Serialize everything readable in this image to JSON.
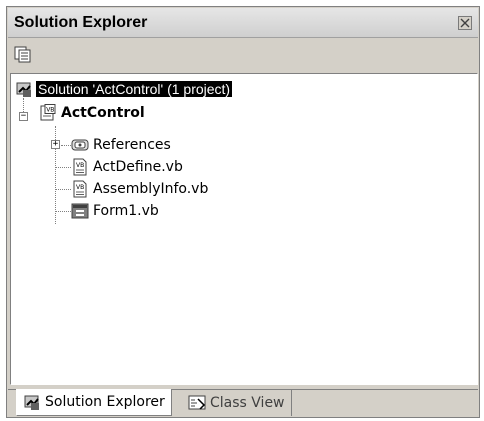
{
  "window": {
    "title": "Solution Explorer"
  },
  "tree": {
    "solution_label": "Solution 'ActControl' (1 project)",
    "project_label": "ActControl",
    "items": [
      {
        "label": "References",
        "icon": "references-icon"
      },
      {
        "label": "ActDefine.vb",
        "icon": "vb-file-icon"
      },
      {
        "label": "AssemblyInfo.vb",
        "icon": "vb-file-icon"
      },
      {
        "label": "Form1.vb",
        "icon": "form-icon"
      }
    ]
  },
  "tabs": [
    {
      "label": "Solution Explorer",
      "icon": "solution-explorer-icon",
      "active": true
    },
    {
      "label": "Class View",
      "icon": "class-view-icon",
      "active": false
    }
  ],
  "colors": {
    "chrome": "#d4d0c8",
    "selection": "#000000"
  }
}
